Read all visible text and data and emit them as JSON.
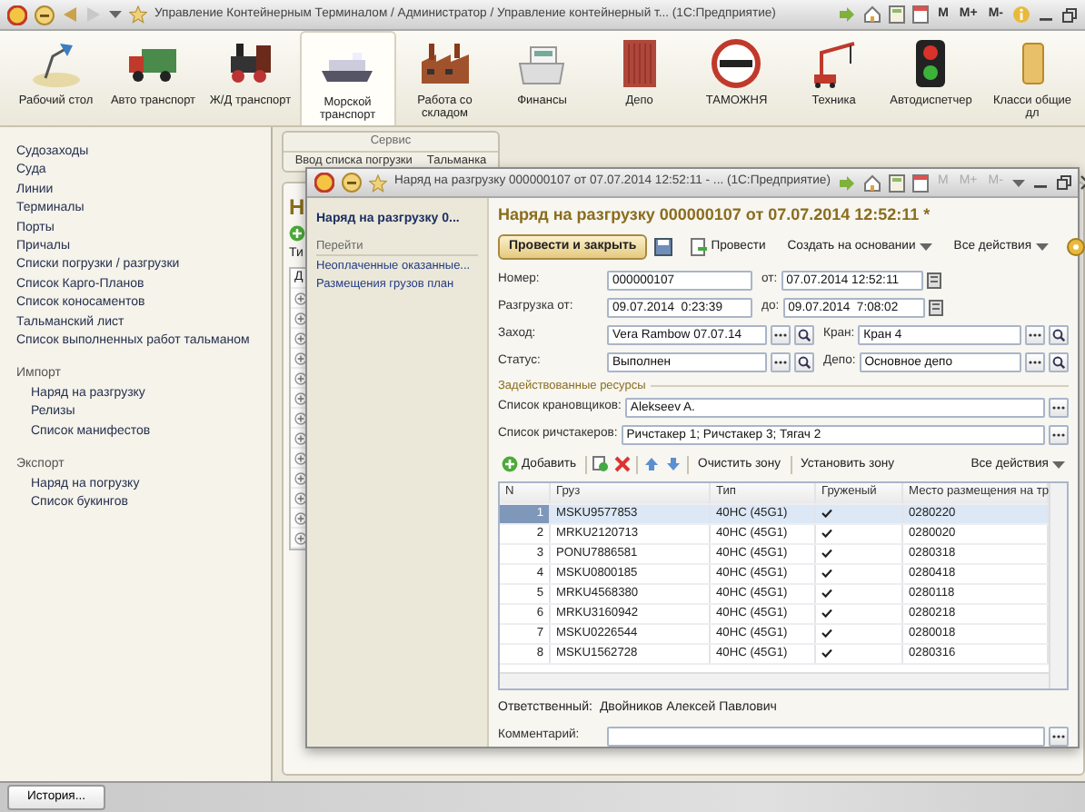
{
  "window": {
    "title": "Управление Контейнерным Терминалом / Администратор / Управление контейнерный т... (1С:Предприятие)",
    "memory_buttons": [
      "M",
      "M+",
      "M-"
    ]
  },
  "sections": [
    {
      "label": "Рабочий стол",
      "selected": false
    },
    {
      "label": "Авто транспорт",
      "selected": false
    },
    {
      "label": "Ж/Д транспорт",
      "selected": false
    },
    {
      "label": "Морской транспорт",
      "selected": true
    },
    {
      "label": "Работа со складом",
      "selected": false
    },
    {
      "label": "Финансы",
      "selected": false
    },
    {
      "label": "Депо",
      "selected": false
    },
    {
      "label": "ТАМОЖНЯ",
      "selected": false
    },
    {
      "label": "Техника",
      "selected": false
    },
    {
      "label": "Автодиспетчер",
      "selected": false
    },
    {
      "label": "Класси общие дл",
      "selected": false
    }
  ],
  "sidebar": {
    "items": [
      {
        "label": "Судозаходы"
      },
      {
        "label": "Суда"
      },
      {
        "label": "Линии"
      },
      {
        "label": "Терминалы"
      },
      {
        "label": "Порты"
      },
      {
        "label": "Причалы"
      },
      {
        "label": "Списки погрузки / разгрузки"
      },
      {
        "label": "Список Карго-Планов"
      },
      {
        "label": "Список коносаментов"
      },
      {
        "label": "Тальманский лист"
      },
      {
        "label": "Список выполненных работ тальманом"
      },
      {
        "label": "Импорт",
        "children": [
          {
            "label": "Наряд на разгрузку"
          },
          {
            "label": "Релизы"
          },
          {
            "label": "Список манифестов"
          }
        ]
      },
      {
        "label": "Экспорт",
        "children": [
          {
            "label": "Наряд на погрузку"
          },
          {
            "label": "Список букингов"
          }
        ]
      }
    ]
  },
  "back_form": {
    "group_title": "Сервис",
    "tabs": [
      "Ввод списка погрузки",
      "Тальманка"
    ],
    "heading": "Н",
    "filter_label": "Ти",
    "column_1": "Д"
  },
  "document": {
    "window_title": "Наряд на разгрузку 000000107 от 07.07.2014 12:52:11 - ... (1С:Предприятие)",
    "memory_buttons": [
      "M",
      "M+",
      "M-"
    ],
    "nav": {
      "title": "Наряд на разгрузку 0...",
      "section": "Перейти",
      "links": [
        "Неоплаченные оказанные...",
        "Размещения грузов план"
      ]
    },
    "heading": "Наряд на разгрузку 000000107 от 07.07.2014 12:52:11 *",
    "toolbar": {
      "primary": "Провести и закрыть",
      "post": "Провести",
      "create_based": "Создать на основании",
      "all_actions": "Все действия"
    },
    "fields": [
      {
        "label": "Номер:",
        "value": "000000107",
        "label_2": "от:",
        "value_2": "07.07.2014 12:52:11",
        "kind": "date"
      },
      {
        "label": "Разгрузка от:",
        "value": "09.07.2014  0:23:39",
        "label_2": "до:",
        "value_2": "09.07.2014  7:08:02",
        "kind": "date"
      },
      {
        "label": "Заход:",
        "value": "Vera Rambow 07.07.14",
        "label_2": "Кран:",
        "value_2": "Кран 4",
        "kind": "ref"
      },
      {
        "label": "Статус:",
        "value": "Выполнен",
        "label_2": "Депо:",
        "value_2": "Основное депо",
        "kind": "ref"
      }
    ],
    "resources": {
      "title": "Задействованные ресурсы",
      "fields": [
        {
          "label": "Список крановщиков:",
          "value": "Alekseev A."
        },
        {
          "label": "Список ричстакеров:",
          "value": "Ричстакер 1; Ричстакер 3; Тягач 2"
        }
      ]
    },
    "table_toolbar": {
      "add": "Добавить",
      "clear_zone": "Очистить зону",
      "set_zone": "Установить зону",
      "all_actions": "Все действия"
    },
    "table": {
      "columns": [
        "N",
        "Груз",
        "Тип",
        "Груженый",
        "Место размещения на тр"
      ],
      "rows": [
        {
          "n": "1",
          "cargo": "MSKU9577853",
          "type": "40HC (45G1)",
          "loaded": true,
          "place": "0280220",
          "selected": true
        },
        {
          "n": "2",
          "cargo": "MRKU2120713",
          "type": "40HC (45G1)",
          "loaded": true,
          "place": "0280020",
          "selected": false
        },
        {
          "n": "3",
          "cargo": "PONU7886581",
          "type": "40HC (45G1)",
          "loaded": true,
          "place": "0280318",
          "selected": false
        },
        {
          "n": "4",
          "cargo": "MSKU0800185",
          "type": "40HC (45G1)",
          "loaded": true,
          "place": "0280418",
          "selected": false
        },
        {
          "n": "5",
          "cargo": "MRKU4568380",
          "type": "40HC (45G1)",
          "loaded": true,
          "place": "0280118",
          "selected": false
        },
        {
          "n": "6",
          "cargo": "MRKU3160942",
          "type": "40HC (45G1)",
          "loaded": true,
          "place": "0280218",
          "selected": false
        },
        {
          "n": "7",
          "cargo": "MSKU0226544",
          "type": "40HC (45G1)",
          "loaded": true,
          "place": "0280018",
          "selected": false
        },
        {
          "n": "8",
          "cargo": "MSKU1562728",
          "type": "40HC (45G1)",
          "loaded": true,
          "place": "0280316",
          "selected": false
        }
      ]
    },
    "responsible": {
      "label": "Ответственный:",
      "value": "Двойников Алексей Павлович"
    },
    "comment": {
      "label": "Комментарий:"
    }
  },
  "bottom_bar": {
    "history_button": "История..."
  }
}
